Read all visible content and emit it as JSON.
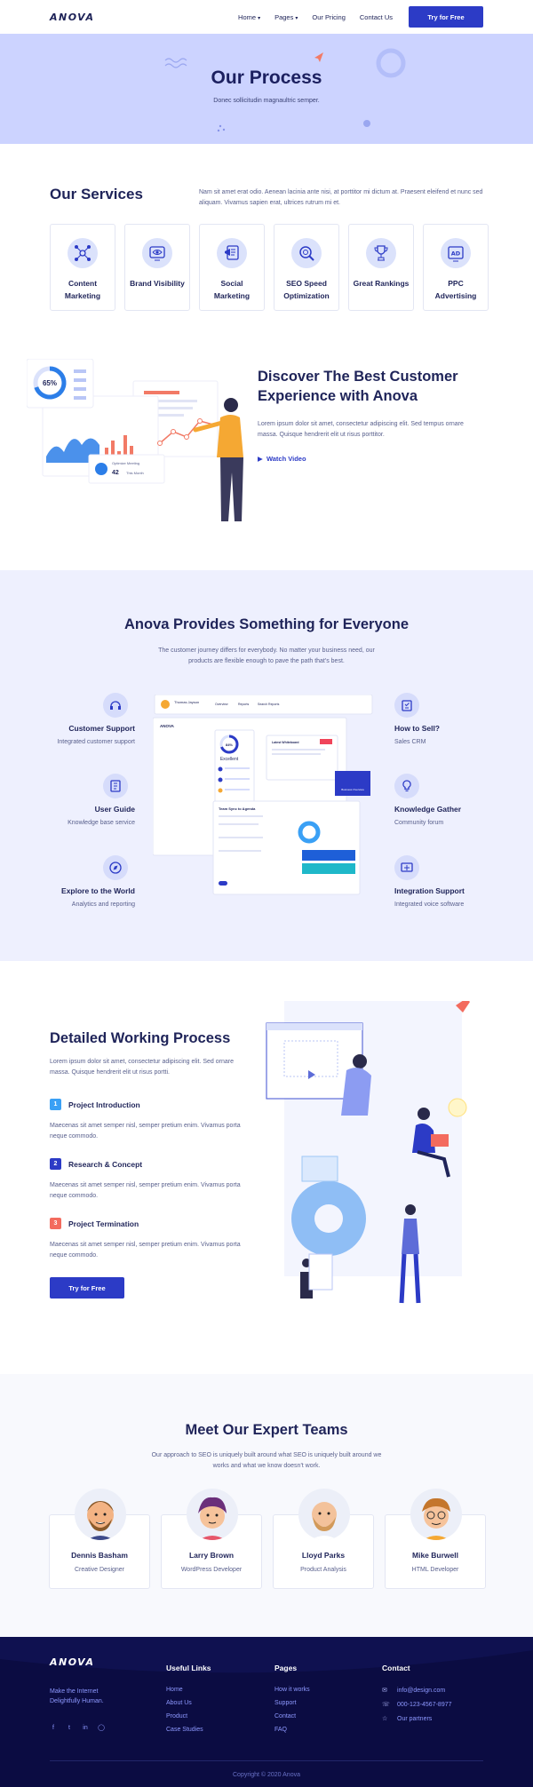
{
  "header": {
    "logo": "ANOVA",
    "nav": [
      {
        "label": "Home",
        "dropdown": true
      },
      {
        "label": "Pages",
        "dropdown": true
      },
      {
        "label": "Our Pricing",
        "dropdown": false
      },
      {
        "label": "Contact Us",
        "dropdown": false
      }
    ],
    "cta": "Try for Free"
  },
  "hero": {
    "title": "Our Process",
    "subtitle": "Donec sollicitudin magnaultric semper."
  },
  "services": {
    "title": "Our Services",
    "description": "Nam sit amet erat odio. Aenean lacinia ante nisi, at porttitor mi dictum at. Praesent eleifend et nunc sed aliquam. Vivamus sapien erat, ultrices rutrum mi et.",
    "items": [
      {
        "label": "Content Marketing",
        "icon": "network-icon"
      },
      {
        "label": "Brand Visibility",
        "icon": "eye-icon"
      },
      {
        "label": "Social Marketing",
        "icon": "megaphone-icon"
      },
      {
        "label": "SEO Speed Optimization",
        "icon": "magnifier-gear-icon"
      },
      {
        "label": "Great Rankings",
        "icon": "trophy-icon"
      },
      {
        "label": "PPC Advertising",
        "icon": "ad-icon"
      }
    ]
  },
  "discover": {
    "title": "Discover The Best Customer Experience with Anova",
    "text": "Lorem ipsum dolor sit amet, consectetur adipiscing elit. Sed tempus ornare massa. Quisque hendrerit elit ut risus porttitor.",
    "watch": "Watch Video",
    "illustration": {
      "donut_value": "65%",
      "optimize_label": "Optimize Meeting",
      "optimize_value": "42",
      "optimize_unit": "This Month"
    }
  },
  "provides": {
    "title": "Anova Provides Something for Everyone",
    "subtitle": "The customer journey differs for everybody. No matter your business need, our products are flexible enough to pave the path that's best.",
    "left": [
      {
        "title": "Customer Support",
        "desc": "Integrated customer support",
        "icon": "headset-icon"
      },
      {
        "title": "User Guide",
        "desc": "Knowledge base service",
        "icon": "book-icon"
      },
      {
        "title": "Explore to the World",
        "desc": "Analytics and reporting",
        "icon": "compass-icon"
      }
    ],
    "right": [
      {
        "title": "How to Sell?",
        "desc": "Sales CRM",
        "icon": "clipboard-icon"
      },
      {
        "title": "Knowledge Gather",
        "desc": "Community forum",
        "icon": "lightbulb-icon"
      },
      {
        "title": "Integration Support",
        "desc": "Integrated voice software",
        "icon": "integration-icon"
      }
    ],
    "dashboard": {
      "user": "Thomas Jayson",
      "tabs": [
        "Overview",
        "Reports",
        "Search Reports"
      ],
      "brand": "ANOVA",
      "score": "84%",
      "score_label": "Excellent",
      "widget_title": "Team Sync to Agenda",
      "latest": "Latest Whiteboard",
      "badge": "Business Overview"
    }
  },
  "process": {
    "title": "Detailed Working Process",
    "desc": "Lorem ipsum dolor sit amet, consectetur adipiscing elit. Sed ornare massa. Quisque hendrerit elit ut risus portti.",
    "steps": [
      {
        "num": "1",
        "title": "Project Introduction",
        "text": "Maecenas sit amet semper nisl, semper pretium enim. Vivamus porta neque commodo.",
        "color": "#3aa0f5"
      },
      {
        "num": "2",
        "title": "Research & Concept",
        "text": "Maecenas sit amet semper nisl, semper pretium enim. Vivamus porta neque commodo.",
        "color": "#2c3bc6"
      },
      {
        "num": "3",
        "title": "Project Termination",
        "text": "Maecenas sit amet semper nisl, semper pretium enim. Vivamus porta neque commodo.",
        "color": "#f36b5e"
      }
    ],
    "cta": "Try for Free"
  },
  "team": {
    "title": "Meet Our Expert Teams",
    "subtitle": "Our approach to SEO is uniquely built around what SEO is uniquely built around we works and what we know doesn't work.",
    "members": [
      {
        "name": "Dennis Basham",
        "role": "Creative Designer"
      },
      {
        "name": "Larry Brown",
        "role": "WordPress Developer"
      },
      {
        "name": "Lloyd Parks",
        "role": "Product Analysis"
      },
      {
        "name": "Mike Burwell",
        "role": "HTML Developer"
      }
    ]
  },
  "footer": {
    "logo": "ANOVA",
    "tagline": "Make the Internet Delightfully Human.",
    "social": [
      "facebook-icon",
      "twitter-icon",
      "linkedin-icon",
      "instagram-icon"
    ],
    "useful_links": {
      "title": "Useful Links",
      "items": [
        "Home",
        "About Us",
        "Product",
        "Case Studies"
      ]
    },
    "pages": {
      "title": "Pages",
      "items": [
        "How it works",
        "Support",
        "Contact",
        "FAQ"
      ]
    },
    "contact": {
      "title": "Contact",
      "items": [
        "info@design.com",
        "000-123-4567-8977",
        "Our partners"
      ]
    },
    "copyright": "Copyright © 2020 Anova"
  },
  "colors": {
    "primary": "#2c3bc6",
    "hero_bg": "#ccd3ff",
    "soft_bg": "#eef0fe",
    "footer_bg": "#0b0c42",
    "link": "#8e99ff"
  }
}
